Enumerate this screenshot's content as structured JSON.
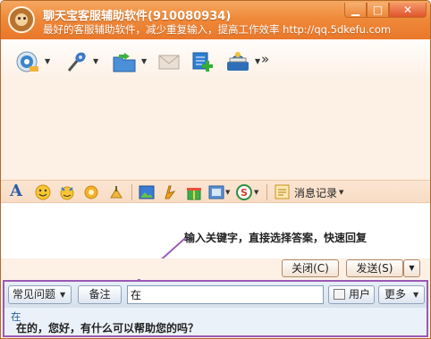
{
  "window": {
    "title": "聊天宝客服辅助软件(910080934)",
    "subtitle": "最好的客服辅助软件，减少重复输入，提高工作效率 http://qq.5dkefu.com",
    "controls": {
      "minimize": "▁",
      "maximize": "□",
      "close": "✕"
    }
  },
  "toolbar": {
    "items": [
      {
        "name": "qq-avatar-icon"
      },
      {
        "name": "microphone-icon"
      },
      {
        "name": "folder-transfer-icon"
      },
      {
        "name": "mail-icon"
      },
      {
        "name": "add-document-icon"
      },
      {
        "name": "remote-assist-icon"
      }
    ],
    "more": "»"
  },
  "format_bar": {
    "font_label": "A",
    "history_label": "消息记录"
  },
  "input_area": {
    "hint": "输入关键字，直接选择答案，快速回复"
  },
  "buttons": {
    "close": "关闭(C)",
    "send": "发送(S)"
  },
  "quick_reply": {
    "common_label": "常见问题",
    "note_label": "备注",
    "search_value": "在",
    "user_label": "用户",
    "more_label": "更多",
    "match_keyword": "在",
    "match_text": "在的，您好，有什么可以帮助您的吗？"
  },
  "colors": {
    "title_bar": "#ef8a3a",
    "highlight_border": "#9b59b6",
    "panel_background": "#eaf1f8"
  }
}
